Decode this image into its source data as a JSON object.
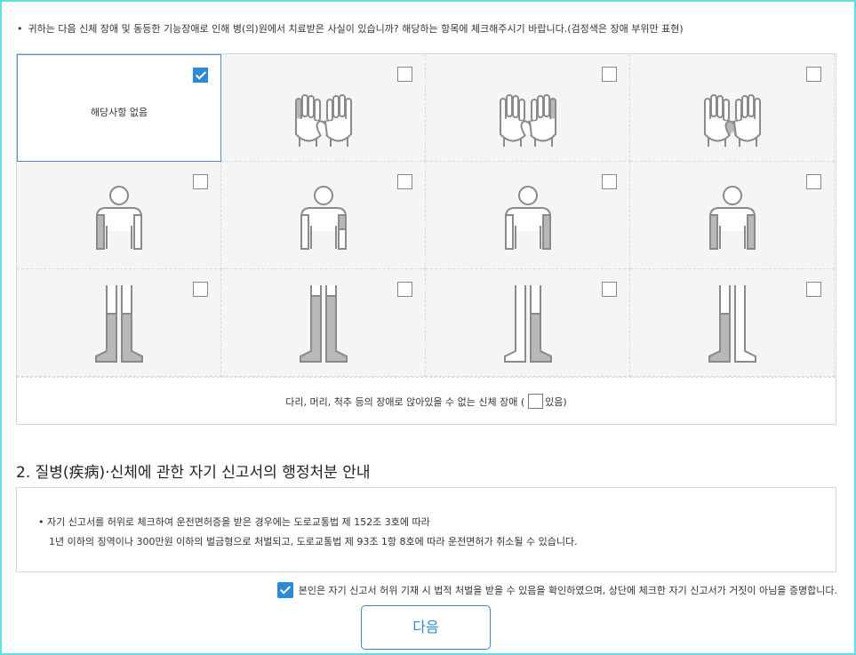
{
  "question": {
    "bullet": "•",
    "text": "귀하는 다음 신체 장애 및 동등한 기능장애로 인해 병(의)원에서 치료받은 사실이 있습니까? 해당하는 항목에 체크해주시기 바랍니다.(검정색은 장애 부위만 표현)"
  },
  "grid": {
    "none_label": "해당사항 없음",
    "cells": [
      {
        "row": "hands",
        "checked": true,
        "is_none": true
      },
      {
        "row": "hands",
        "checked": false,
        "icon": "both-hands-left-fingers-icon"
      },
      {
        "row": "hands",
        "checked": false,
        "icon": "both-hands-right-fingers-icon"
      },
      {
        "row": "hands",
        "checked": false,
        "icon": "both-hands-thumbs-icon"
      },
      {
        "row": "arms",
        "checked": false,
        "icon": "left-arm-icon"
      },
      {
        "row": "arms",
        "checked": false,
        "icon": "right-upper-arm-icon"
      },
      {
        "row": "arms",
        "checked": false,
        "icon": "right-arm-icon"
      },
      {
        "row": "arms",
        "checked": false,
        "icon": "both-arms-icon"
      },
      {
        "row": "legs",
        "checked": false,
        "icon": "both-legs-lower-icon"
      },
      {
        "row": "legs",
        "checked": false,
        "icon": "both-legs-full-icon"
      },
      {
        "row": "legs",
        "checked": false,
        "icon": "right-leg-icon"
      },
      {
        "row": "legs",
        "checked": false,
        "icon": "left-leg-icon"
      }
    ],
    "bottom_text_before": "다리, 머리, 척추 등의 장애로 앉아있을 수 없는 신체 장애 (",
    "bottom_text_after": "있음)",
    "bottom_checked": false
  },
  "section": {
    "title": "2. 질병(疾病)·신체에 관한 자기 신고서의 행정처분 안내"
  },
  "notice": {
    "line1": "• 자기 신고서를 허위로 체크하여 운전면허증을 받은 경우에는 도로교통법 제 152조 3호에 따라",
    "line2": "1년 이하의 징역이나 300만원 이하의 벌금형으로 처벌되고, 도로교통법 제 93조 1항 8호에 따라 운전면허가 취소될 수 있습니다."
  },
  "confirm": {
    "checked": true,
    "text": "본인은 자기 신고서 허위 기재 시 법적 처벌을 받을 수 있음을 확인하였으며, 상단에 체크한 자기 신고서가 거짓이 아님을 증명합니다."
  },
  "next_button": {
    "label": "다음"
  },
  "colors": {
    "accent": "#2f8ad6",
    "frame": "#5fe0e6",
    "highlight_gray": "#b8b8b8",
    "outline_gray": "#8a8a8a"
  }
}
